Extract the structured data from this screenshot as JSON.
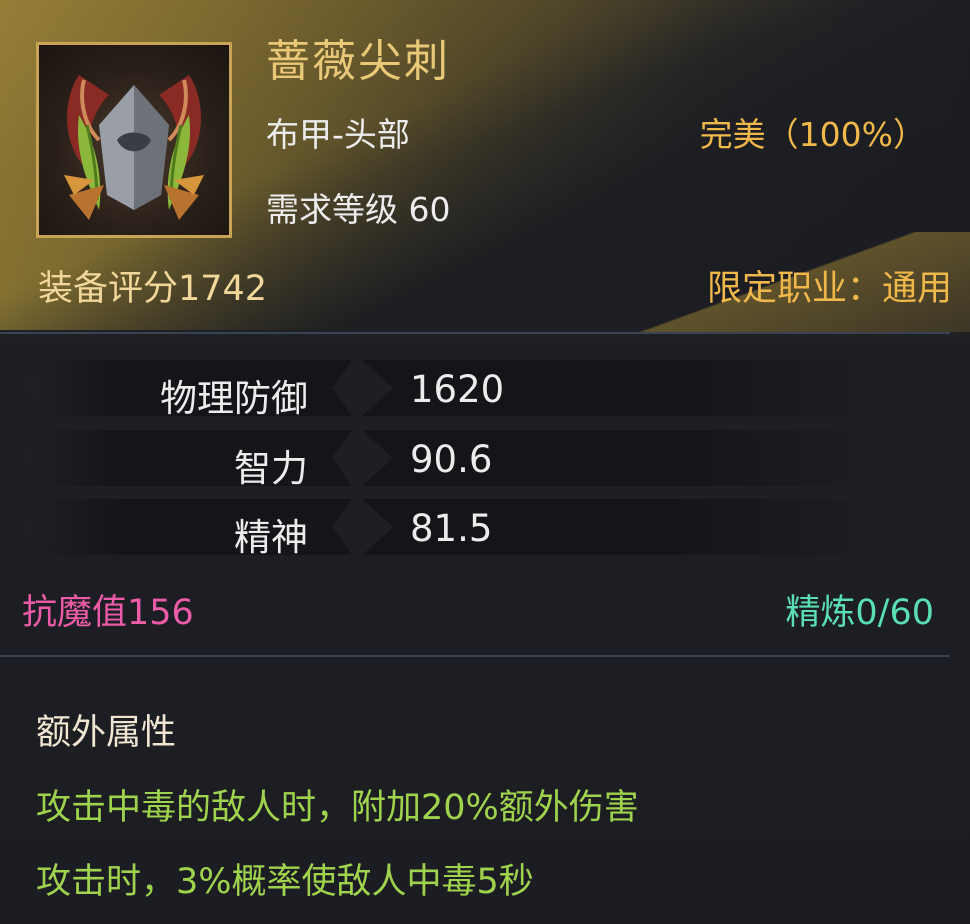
{
  "item": {
    "name": "蔷薇尖刺",
    "type": "布甲-头部",
    "required_level": "需求等级 60",
    "quality": "完美（100%）",
    "score": "装备评分1742",
    "class_restriction": "限定职业：通用",
    "icon": "thorned-helmet-icon"
  },
  "stats": [
    {
      "label": "物理防御",
      "value": "1620"
    },
    {
      "label": "智力",
      "value": "90.6"
    },
    {
      "label": "精神",
      "value": "81.5"
    }
  ],
  "resistance": "抗魔值156",
  "refine": "精炼0/60",
  "extra": {
    "title": "额外属性",
    "lines": [
      "攻击中毒的敌人时，附加20%额外伤害",
      "攻击时，3%概率使敌人中毒5秒"
    ]
  },
  "colors": {
    "name": "#e9c978",
    "quality": "#f0b84a",
    "resistance": "#ec5ba7",
    "refine": "#59dfb2",
    "extra_lines": "#9fd34d"
  }
}
